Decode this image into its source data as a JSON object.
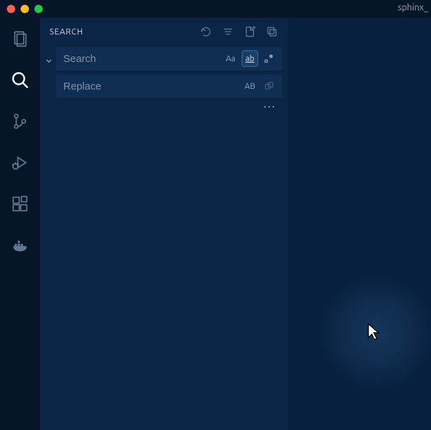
{
  "titlebar": {
    "title": "sphinx_"
  },
  "activity": {
    "items": [
      {
        "name": "explorer"
      },
      {
        "name": "search",
        "active": true
      },
      {
        "name": "source-control"
      },
      {
        "name": "run-debug"
      },
      {
        "name": "extensions"
      },
      {
        "name": "docker"
      }
    ]
  },
  "sidebar": {
    "title": "SEARCH",
    "actions": {
      "refresh": "refresh",
      "clear": "clear",
      "newfile": "new-file",
      "collapse": "collapse"
    }
  },
  "search": {
    "placeholder": "Search",
    "value": "",
    "options": {
      "matchCase": "Aa",
      "matchWholeWord": "ab",
      "useRegex": ".*"
    }
  },
  "replace": {
    "placeholder": "Replace",
    "value": "",
    "preserveCase": "AB"
  },
  "more": "⋯"
}
